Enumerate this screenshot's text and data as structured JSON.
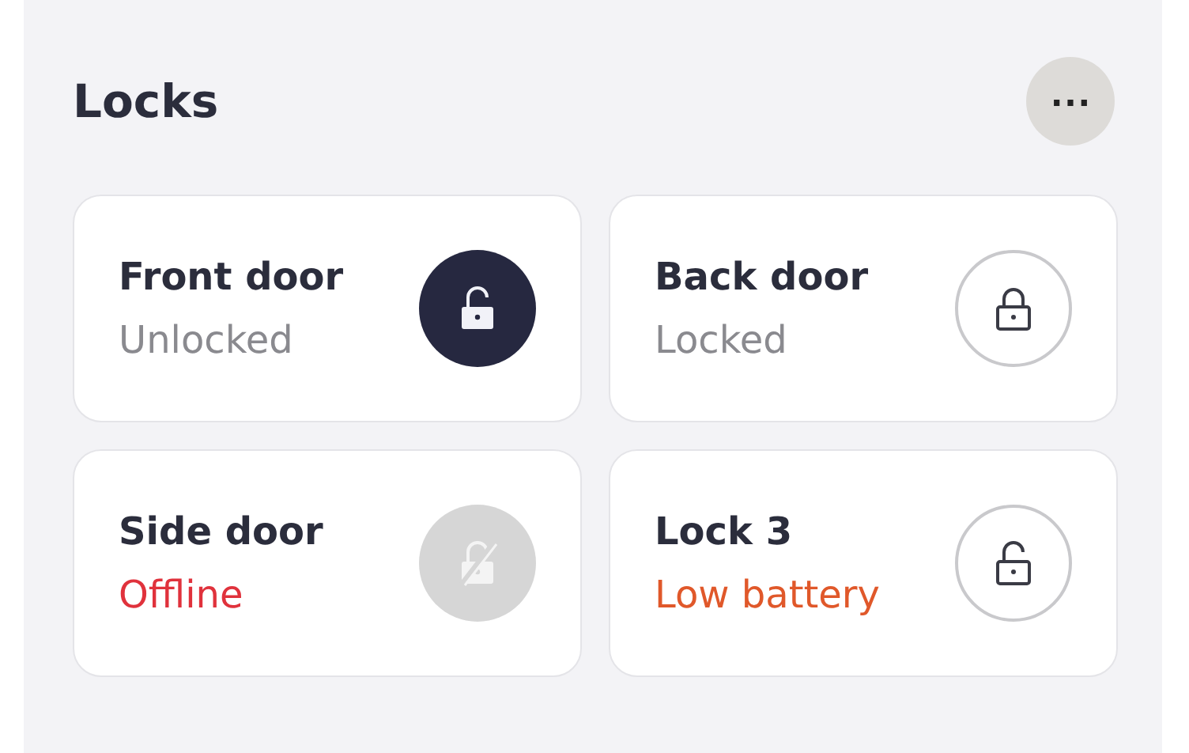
{
  "section": {
    "title": "Locks",
    "more_button": "⋯"
  },
  "locks": [
    {
      "name": "Front door",
      "status": "Unlocked",
      "color": "#8a8a8f",
      "locked": false,
      "kind": "filled"
    },
    {
      "name": "Back door",
      "status": "Locked",
      "color": "#8a8a8f",
      "locked": true,
      "kind": "outline"
    },
    {
      "name": "Side door",
      "status": "Offline",
      "color": "#e0323c",
      "locked": false,
      "kind": "disabled"
    },
    {
      "name": "Lock 3",
      "status": "Low battery",
      "color": "#e0582a",
      "locked": false,
      "kind": "outline"
    }
  ]
}
